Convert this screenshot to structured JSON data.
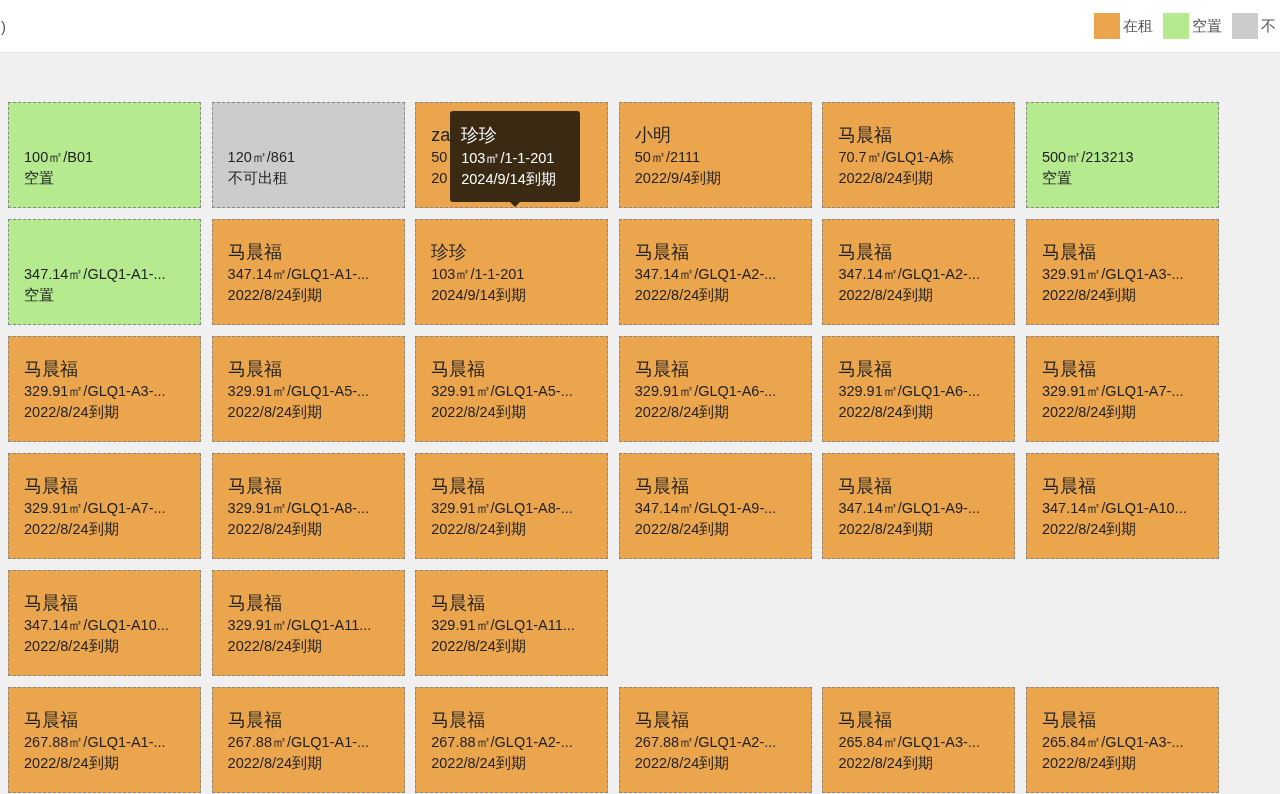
{
  "header": {
    "title_fragment": ")",
    "legend": [
      {
        "label": "在租",
        "color": "#eba54d"
      },
      {
        "label": "空置",
        "color": "#b5ea8f"
      },
      {
        "label": "不",
        "color": "#cccccc"
      }
    ]
  },
  "rows": [
    [
      {
        "kind": "vacant",
        "area": "100㎡/B01",
        "note": "空置"
      },
      {
        "kind": "unavailable",
        "area": "120㎡/861",
        "note": "不可出租"
      },
      {
        "kind": "rented",
        "name": "za",
        "area": "50",
        "note": "20",
        "tooltip": {
          "name": "珍珍",
          "area": "103㎡/1-1-201",
          "note": "2024/9/14到期"
        }
      },
      {
        "kind": "rented",
        "name": "小明",
        "area": "50㎡/2111",
        "note": "2022/9/4到期"
      },
      {
        "kind": "rented",
        "name": "马晨福",
        "area": "70.7㎡/GLQ1-A栋",
        "note": "2022/8/24到期"
      },
      {
        "kind": "vacant",
        "area": "500㎡/213213",
        "note": "空置"
      }
    ],
    [
      {
        "kind": "vacant",
        "area": "347.14㎡/GLQ1-A1-...",
        "note": "空置"
      },
      {
        "kind": "rented",
        "name": "马晨福",
        "area": "347.14㎡/GLQ1-A1-...",
        "note": "2022/8/24到期"
      },
      {
        "kind": "rented",
        "name": "珍珍",
        "area": "103㎡/1-1-201",
        "note": "2024/9/14到期"
      },
      {
        "kind": "rented",
        "name": "马晨福",
        "area": "347.14㎡/GLQ1-A2-...",
        "note": "2022/8/24到期"
      },
      {
        "kind": "rented",
        "name": "马晨福",
        "area": "347.14㎡/GLQ1-A2-...",
        "note": "2022/8/24到期"
      },
      {
        "kind": "rented",
        "name": "马晨福",
        "area": "329.91㎡/GLQ1-A3-...",
        "note": "2022/8/24到期"
      }
    ],
    [
      {
        "kind": "rented",
        "name": "马晨福",
        "area": "329.91㎡/GLQ1-A3-...",
        "note": "2022/8/24到期"
      },
      {
        "kind": "rented",
        "name": "马晨福",
        "area": "329.91㎡/GLQ1-A5-...",
        "note": "2022/8/24到期"
      },
      {
        "kind": "rented",
        "name": "马晨福",
        "area": "329.91㎡/GLQ1-A5-...",
        "note": "2022/8/24到期"
      },
      {
        "kind": "rented",
        "name": "马晨福",
        "area": "329.91㎡/GLQ1-A6-...",
        "note": "2022/8/24到期"
      },
      {
        "kind": "rented",
        "name": "马晨福",
        "area": "329.91㎡/GLQ1-A6-...",
        "note": "2022/8/24到期"
      },
      {
        "kind": "rented",
        "name": "马晨福",
        "area": "329.91㎡/GLQ1-A7-...",
        "note": "2022/8/24到期"
      }
    ],
    [
      {
        "kind": "rented",
        "name": "马晨福",
        "area": "329.91㎡/GLQ1-A7-...",
        "note": "2022/8/24到期"
      },
      {
        "kind": "rented",
        "name": "马晨福",
        "area": "329.91㎡/GLQ1-A8-...",
        "note": "2022/8/24到期"
      },
      {
        "kind": "rented",
        "name": "马晨福",
        "area": "329.91㎡/GLQ1-A8-...",
        "note": "2022/8/24到期"
      },
      {
        "kind": "rented",
        "name": "马晨福",
        "area": "347.14㎡/GLQ1-A9-...",
        "note": "2022/8/24到期"
      },
      {
        "kind": "rented",
        "name": "马晨福",
        "area": "347.14㎡/GLQ1-A9-...",
        "note": "2022/8/24到期"
      },
      {
        "kind": "rented",
        "name": "马晨福",
        "area": "347.14㎡/GLQ1-A10...",
        "note": "2022/8/24到期"
      }
    ],
    [
      {
        "kind": "rented",
        "name": "马晨福",
        "area": "347.14㎡/GLQ1-A10...",
        "note": "2022/8/24到期"
      },
      {
        "kind": "rented",
        "name": "马晨福",
        "area": "329.91㎡/GLQ1-A11...",
        "note": "2022/8/24到期"
      },
      {
        "kind": "rented",
        "name": "马晨福",
        "area": "329.91㎡/GLQ1-A11...",
        "note": "2022/8/24到期"
      }
    ],
    [
      {
        "kind": "rented",
        "name": "马晨福",
        "area": "267.88㎡/GLQ1-A1-...",
        "note": "2022/8/24到期"
      },
      {
        "kind": "rented",
        "name": "马晨福",
        "area": "267.88㎡/GLQ1-A1-...",
        "note": "2022/8/24到期"
      },
      {
        "kind": "rented",
        "name": "马晨福",
        "area": "267.88㎡/GLQ1-A2-...",
        "note": "2022/8/24到期"
      },
      {
        "kind": "rented",
        "name": "马晨福",
        "area": "267.88㎡/GLQ1-A2-...",
        "note": "2022/8/24到期"
      },
      {
        "kind": "rented",
        "name": "马晨福",
        "area": "265.84㎡/GLQ1-A3-...",
        "note": "2022/8/24到期"
      },
      {
        "kind": "rented",
        "name": "马晨福",
        "area": "265.84㎡/GLQ1-A3-...",
        "note": "2022/8/24到期"
      }
    ]
  ]
}
